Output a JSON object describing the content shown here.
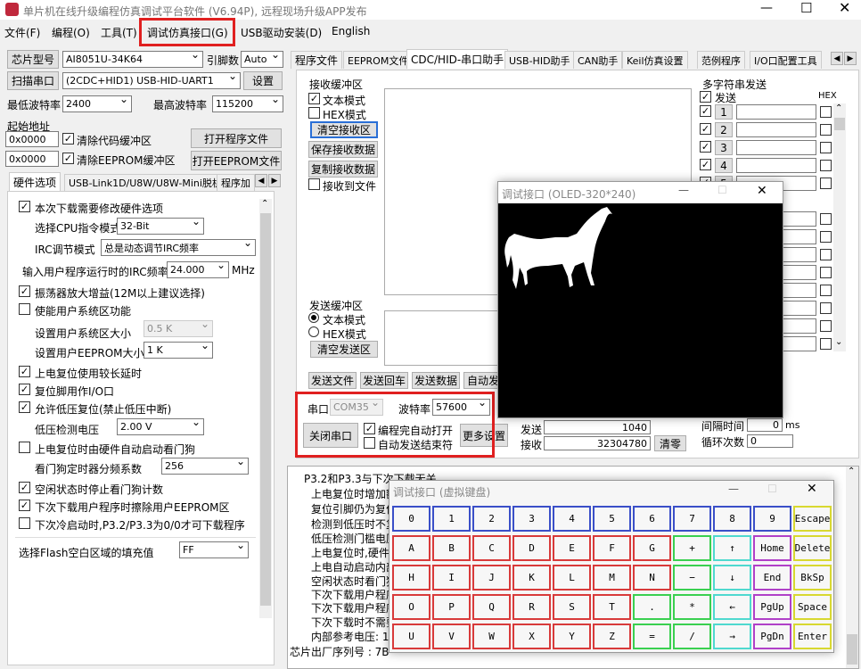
{
  "title": "单片机在线升级编程仿真调试平台软件 (V6.94P), 远程现场升级APP发布",
  "menu": [
    "文件(F)",
    "编程(O)",
    "工具(T)",
    "调试仿真接口(G)",
    "USB驱动安装(D)",
    "English"
  ],
  "left": {
    "chip_btn": "芯片型号",
    "chip": "AI8051U-34K64",
    "pin_label": "引脚数",
    "pin": "Auto",
    "scan_btn": "扫描串口",
    "port": "(2CDC+HID1) USB-HID-UART1",
    "set_btn": "设置",
    "min_baud_label": "最低波特率",
    "min_baud": "2400",
    "max_baud_label": "最高波特率",
    "max_baud": "115200",
    "start_addr_label": "起始地址",
    "addr1": "0x0000",
    "clear_code": "清除代码缓冲区",
    "open_prog": "打开程序文件",
    "addr2": "0x0000",
    "clear_eeprom": "清除EEPROM缓冲区",
    "open_eeprom": "打开EEPROM文件",
    "tabs": [
      "硬件选项",
      "USB-Link1D/U8W/U8W-Mini脱机",
      "程序加"
    ],
    "opts": {
      "o1": "本次下载需要修改硬件选项",
      "cpu_label": "选择CPU指令模式",
      "cpu": "32-Bit",
      "irc_label": "IRC调节模式",
      "irc": "总是动态调节IRC频率",
      "freq_label": "输入用户程序运行时的IRC频率",
      "freq": "24.000",
      "mhz": "MHz",
      "o2": "振荡器放大增益(12M以上建议选择)",
      "o3": "使能用户系统区功能",
      "sys_label": "设置用户系统区大小",
      "sys": "0.5 K",
      "ee_label": "设置用户EEPROM大小",
      "ee": "1  K",
      "o4": "上电复位使用较长延时",
      "o5": "复位脚用作I/O口",
      "o6": "允许低压复位(禁止低压中断)",
      "lv_label": "低压检测电压",
      "lv": "2.00 V",
      "o7": "上电复位时由硬件自动启动看门狗",
      "wd_label": "看门狗定时器分频系数",
      "wd": "256",
      "o8": "空闲状态时停止看门狗计数",
      "o9": "下次下载用户程序时擦除用户EEPROM区",
      "o10": "下次冷启动时,P3.2/P3.3为0/0才可下载程序",
      "fill_label": "选择Flash空白区域的填充值",
      "fill": "FF"
    }
  },
  "rtabs": [
    "程序文件",
    "EEPROM文件",
    "CDC/HID-串口助手",
    "USB-HID助手",
    "CAN助手",
    "Keil仿真设置",
    "范例程序",
    "I/O口配置工具"
  ],
  "recv": {
    "title": "接收缓冲区",
    "text_mode": "文本模式",
    "hex_mode": "HEX模式",
    "clear": "清空接收区",
    "save": "保存接收数据",
    "copy": "复制接收数据",
    "to_file": "接收到文件"
  },
  "multi": {
    "title": "多字符串发送",
    "send": "发送",
    "hex": "HEX",
    "rows": [
      "1",
      "2",
      "3",
      "4",
      "5"
    ]
  },
  "send_area": {
    "title": "发送缓冲区",
    "text_mode": "文本模式",
    "hex_mode": "HEX模式",
    "clear": "清空发送区",
    "b1": "发送文件",
    "b2": "发送回车",
    "b3": "发送数据",
    "b4": "自动发"
  },
  "serial": {
    "port_label": "串口",
    "port": "COM35",
    "baud_label": "波特率",
    "baud": "57600",
    "close": "关闭串口",
    "auto_open": "编程完自动打开",
    "auto_end": "自动发送结束符",
    "more": "更多设置"
  },
  "counts": {
    "send_label": "发送",
    "send": "1040",
    "recv_label": "接收",
    "recv": "32304780",
    "clear": "清零",
    "interval_label": "间隔时间",
    "interval": "0",
    "ms": "ms",
    "loop_label": "循环次数",
    "loop": "0"
  },
  "log": [
    "P3.2和P3.3与下次下载无关",
    "上电复位时增加额",
    "复位引脚仍为复位",
    "检测到低压时不复",
    "低压检测门槛电压",
    "上电复位时,硬件",
    "上电自动启动内部",
    "空闲状态时看门狗",
    "下次下载用户程序",
    "下次下载用户程序",
    "下次下载时不需要",
    "内部参考电压: 1",
    "芯片出厂序列号 : 7B"
  ],
  "oled": {
    "title": "调试接口 (OLED-320*240)"
  },
  "kbd": {
    "title": "调试接口 (虚拟键盘)",
    "keys": [
      [
        "0",
        "1",
        "2",
        "3",
        "4",
        "5",
        "6",
        "7",
        "8",
        "9",
        "Escape"
      ],
      [
        "A",
        "B",
        "C",
        "D",
        "E",
        "F",
        "G",
        "+",
        "↑",
        "Home",
        "Delete"
      ],
      [
        "H",
        "I",
        "J",
        "K",
        "L",
        "M",
        "N",
        "−",
        "↓",
        "End",
        "BkSp"
      ],
      [
        "O",
        "P",
        "Q",
        "R",
        "S",
        "T",
        ".",
        "*",
        "←",
        "PgUp",
        "Space"
      ],
      [
        "U",
        "V",
        "W",
        "X",
        "Y",
        "Z",
        "=",
        "/",
        "→",
        "PgDn",
        "Enter"
      ]
    ]
  }
}
